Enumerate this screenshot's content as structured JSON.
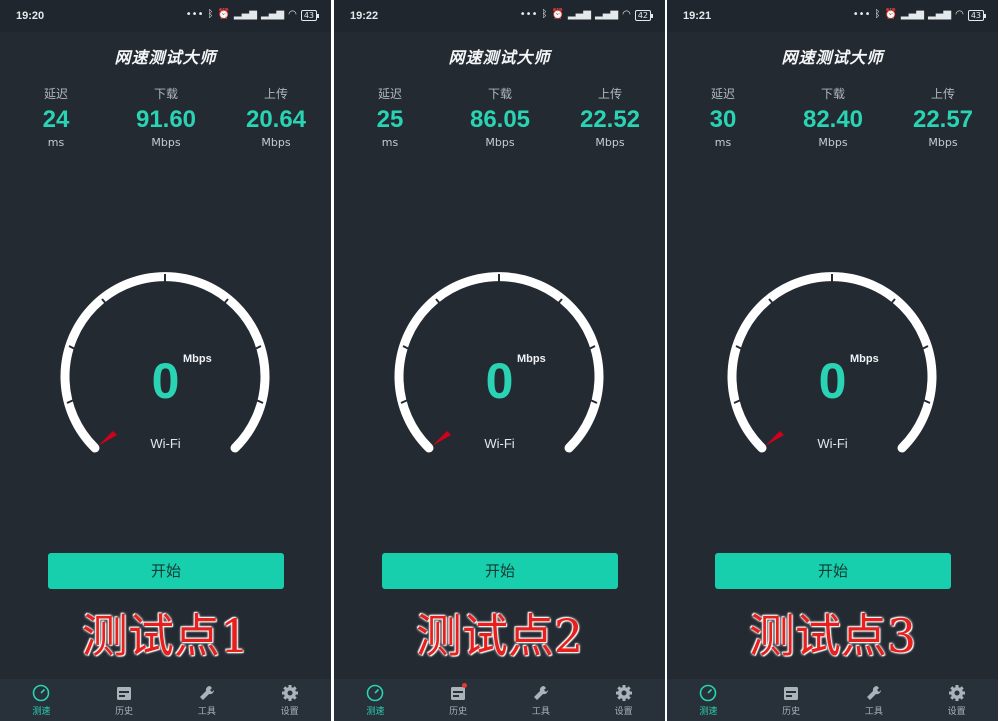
{
  "panels": [
    {
      "status": {
        "time": "19:20",
        "battery": "43"
      },
      "app_title": "网速测试大师",
      "metrics": {
        "latency": {
          "label": "延迟",
          "value": "24",
          "unit": "ms"
        },
        "download": {
          "label": "下载",
          "value": "91.60",
          "unit": "Mbps"
        },
        "upload": {
          "label": "上传",
          "value": "20.64",
          "unit": "Mbps"
        }
      },
      "gauge": {
        "value": "0",
        "unit": "Mbps",
        "connection": "Wi-Fi"
      },
      "start_label": "开始",
      "overlay": "测试点1",
      "nav": {
        "items": [
          "测速",
          "历史",
          "工具",
          "设置"
        ],
        "active": 0,
        "history_badge": false
      }
    },
    {
      "status": {
        "time": "19:22",
        "battery": "42"
      },
      "app_title": "网速测试大师",
      "metrics": {
        "latency": {
          "label": "延迟",
          "value": "25",
          "unit": "ms"
        },
        "download": {
          "label": "下载",
          "value": "86.05",
          "unit": "Mbps"
        },
        "upload": {
          "label": "上传",
          "value": "22.52",
          "unit": "Mbps"
        }
      },
      "gauge": {
        "value": "0",
        "unit": "Mbps",
        "connection": "Wi-Fi"
      },
      "start_label": "开始",
      "overlay": "测试点2",
      "nav": {
        "items": [
          "测速",
          "历史",
          "工具",
          "设置"
        ],
        "active": 0,
        "history_badge": true
      }
    },
    {
      "status": {
        "time": "19:21",
        "battery": "43"
      },
      "app_title": "网速测试大师",
      "metrics": {
        "latency": {
          "label": "延迟",
          "value": "30",
          "unit": "ms"
        },
        "download": {
          "label": "下载",
          "value": "82.40",
          "unit": "Mbps"
        },
        "upload": {
          "label": "上传",
          "value": "22.57",
          "unit": "Mbps"
        }
      },
      "gauge": {
        "value": "0",
        "unit": "Mbps",
        "connection": "Wi-Fi"
      },
      "start_label": "开始",
      "overlay": "测试点3",
      "nav": {
        "items": [
          "测速",
          "历史",
          "工具",
          "设置"
        ],
        "active": 0,
        "history_badge": false
      }
    }
  ],
  "colors": {
    "accent": "#29d3b3",
    "button": "#18cfad",
    "panel_bg": "#232a32",
    "needle": "#d0021b"
  },
  "icons": [
    "bluetooth-icon",
    "alarm-icon",
    "signal-icon",
    "wifi-icon",
    "battery-icon",
    "speedometer-icon",
    "calendar-icon",
    "wrench-icon",
    "gear-icon"
  ]
}
